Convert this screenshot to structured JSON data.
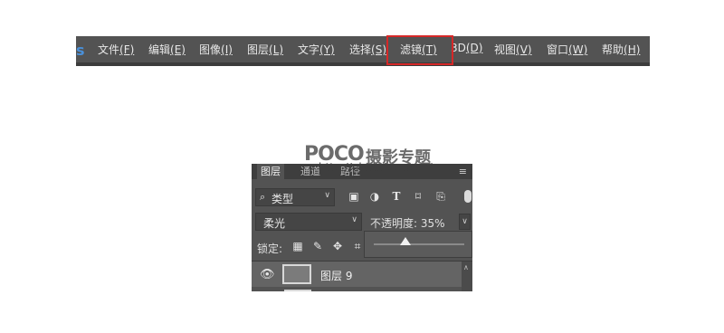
{
  "menubar": {
    "logo": "s",
    "items": [
      {
        "label": "文件",
        "key": "(F)"
      },
      {
        "label": "编辑",
        "key": "(E)"
      },
      {
        "label": "图像",
        "key": "(I)"
      },
      {
        "label": "图层",
        "key": "(L)"
      },
      {
        "label": "文字",
        "key": "(Y)"
      },
      {
        "label": "选择",
        "key": "(S)"
      },
      {
        "label": "滤镜",
        "key": "(T)"
      },
      {
        "label": "3D",
        "key": "(D)"
      },
      {
        "label": "视图",
        "key": "(V)"
      },
      {
        "label": "窗口",
        "key": "(W)"
      },
      {
        "label": "帮助",
        "key": "(H)"
      }
    ],
    "highlight_color": "#d62828"
  },
  "watermark": {
    "brand": "POCO",
    "brand_cn": "摄影专题",
    "url": "http://photo.poco.cn/"
  },
  "layers_panel": {
    "tabs": [
      "图层",
      "通道",
      "路径"
    ],
    "menu_icon": "hamburger-icon",
    "filter": {
      "search_icon": "⌕",
      "kind": "类型"
    },
    "filter_icons": [
      "image-filter-icon",
      "adjustment-filter-icon",
      "text-filter-icon",
      "shape-filter-icon",
      "smart-object-filter-icon"
    ],
    "blend_mode": "柔光",
    "opacity_label": "不透明度:",
    "opacity_value": "35%",
    "opacity_fraction": 0.35,
    "lock_label": "锁定:",
    "lock_icons": [
      "lock-transparency-icon",
      "lock-image-pixels-icon",
      "lock-position-icon",
      "lock-artboard-icon"
    ],
    "layer": {
      "name": "图层 9",
      "visible": true
    }
  }
}
